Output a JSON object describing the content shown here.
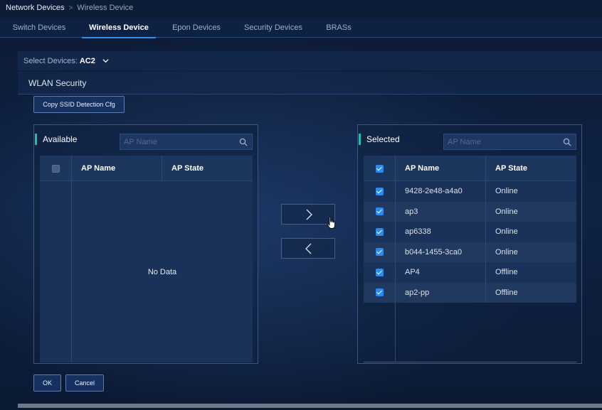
{
  "breadcrumb": {
    "root": "Network Devices",
    "separator": ">",
    "current": "Wireless Device"
  },
  "tabs": [
    {
      "label": "Switch Devices",
      "active": false
    },
    {
      "label": "Wireless Device",
      "active": true
    },
    {
      "label": "Epon Devices",
      "active": false
    },
    {
      "label": "Security Devices",
      "active": false
    },
    {
      "label": "BRASs",
      "active": false
    }
  ],
  "device_select": {
    "label": "Select Devices:",
    "value": "AC2"
  },
  "section": {
    "title": "WLAN Security"
  },
  "copy_button": {
    "label": "Copy SSID Detection Cfg"
  },
  "available": {
    "title": "Available",
    "search_placeholder": "AP Name",
    "columns": {
      "name": "AP Name",
      "state": "AP State"
    },
    "empty_text": "No Data",
    "rows": []
  },
  "selected": {
    "title": "Selected",
    "search_placeholder": "AP Name",
    "columns": {
      "name": "AP Name",
      "state": "AP State"
    },
    "rows": [
      {
        "name": "9428-2e48-a4a0",
        "state": "Online"
      },
      {
        "name": "ap3",
        "state": "Online"
      },
      {
        "name": "ap6338",
        "state": "Online"
      },
      {
        "name": "b044-1455-3ca0",
        "state": "Online"
      },
      {
        "name": "AP4",
        "state": "Offline"
      },
      {
        "name": "ap2-pp",
        "state": "Offline"
      }
    ]
  },
  "move_buttons": {
    "right_icon": "chevron-right-icon",
    "left_icon": "chevron-left-icon"
  },
  "footer": {
    "ok_label": "OK",
    "cancel_label": "Cancel"
  },
  "colors": {
    "accent": "#2f8ff0",
    "title_marker": "#1fc2a7",
    "checkbox_on": "#2a8af0"
  }
}
